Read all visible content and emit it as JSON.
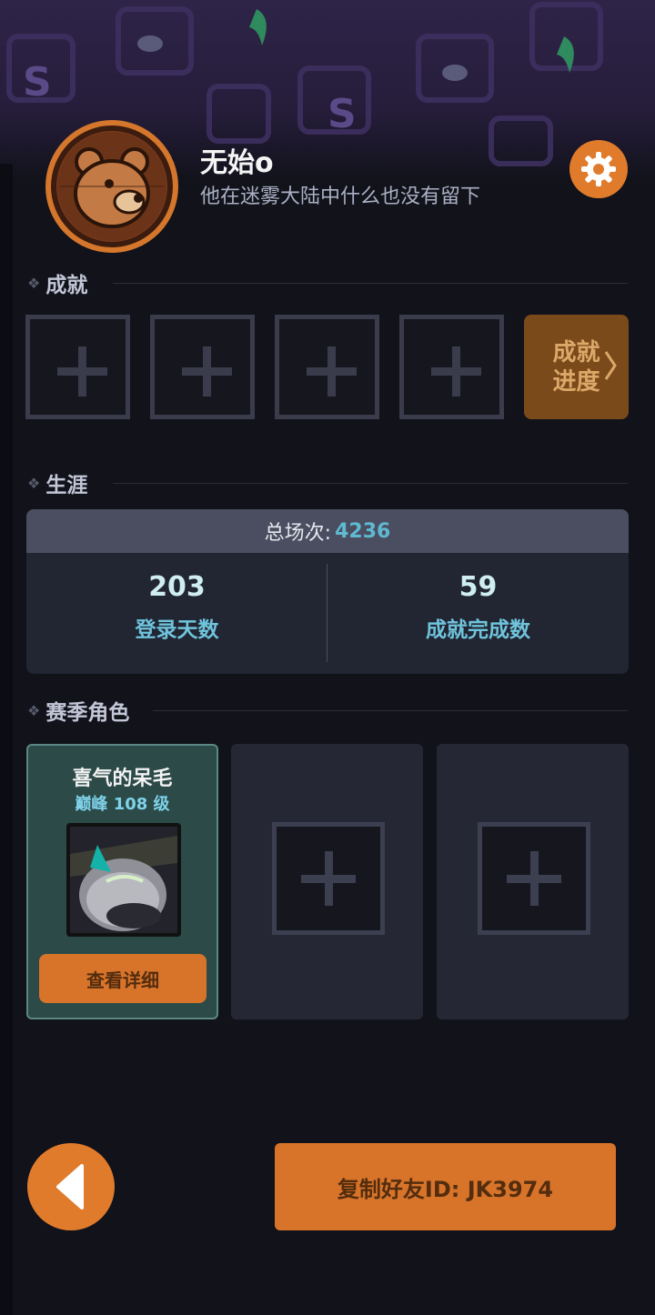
{
  "profile": {
    "username": "无始o",
    "signature": "他在迷雾大陆中什么也没有留下"
  },
  "sections": {
    "achievements": "成就",
    "career": "生涯",
    "season_characters": "赛季角色"
  },
  "achievements": {
    "progress_label": "成就进度",
    "empty_slots": 4
  },
  "career": {
    "total_label": "总场次:",
    "total_value": "4236",
    "stats": [
      {
        "value": "203",
        "label": "登录天数"
      },
      {
        "value": "59",
        "label": "成就完成数"
      }
    ]
  },
  "characters": [
    {
      "name": "喜气的呆毛",
      "level": "巅峰 108 级",
      "button": "查看详细"
    }
  ],
  "footer": {
    "copy_id_label": "复制好友ID: JK3974"
  },
  "colors": {
    "accent_orange": "#e07b2c",
    "stat_cyan": "#6fc4dc",
    "background": "#11121a"
  }
}
